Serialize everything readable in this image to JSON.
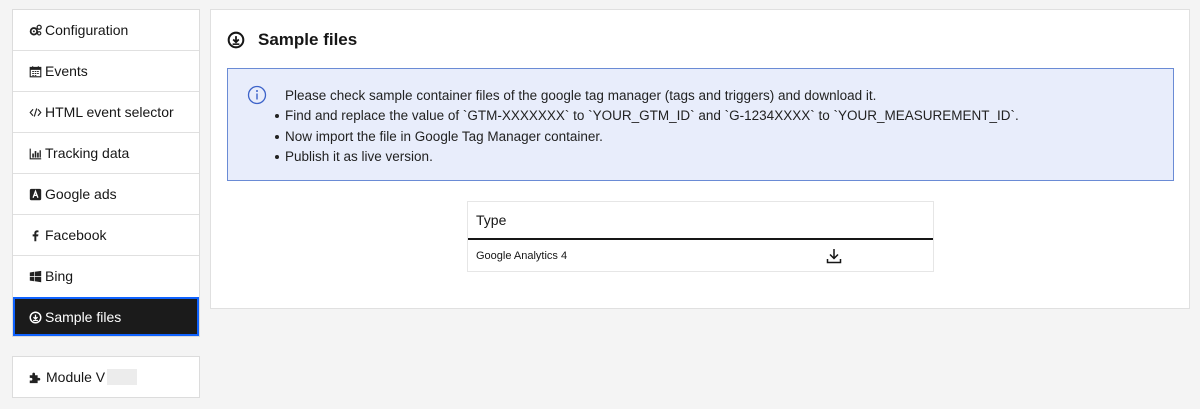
{
  "sidebar": {
    "items": [
      {
        "label": "Configuration",
        "icon": "gears-icon"
      },
      {
        "label": "Events",
        "icon": "calendar-icon"
      },
      {
        "label": "HTML event selector",
        "icon": "code-icon"
      },
      {
        "label": "Tracking data",
        "icon": "bar-chart-icon"
      },
      {
        "label": "Google ads",
        "icon": "google-ads-icon"
      },
      {
        "label": "Facebook",
        "icon": "facebook-icon"
      },
      {
        "label": "Bing",
        "icon": "windows-icon"
      },
      {
        "label": "Sample files",
        "icon": "download-circle-icon",
        "active": true
      }
    ],
    "module": {
      "label": "Module V",
      "icon": "puzzle-icon"
    }
  },
  "main": {
    "title": "Sample files",
    "info": {
      "intro": "Please check sample container files of the google tag manager (tags and triggers) and download it.",
      "bullets": [
        "Find and replace the value of `GTM-XXXXXXX` to `YOUR_GTM_ID` and `G-1234XXXX` to `YOUR_MEASUREMENT_ID`.",
        "Now import the file in Google Tag Manager container.",
        "Publish it as live version."
      ]
    },
    "table": {
      "header": "Type",
      "rows": [
        {
          "type": "Google Analytics 4"
        }
      ]
    }
  },
  "colors": {
    "active_bg": "#1b1b1b",
    "active_outline": "#0f62fe",
    "info_bg": "#e8edfb",
    "info_border": "#6a8bd5"
  }
}
